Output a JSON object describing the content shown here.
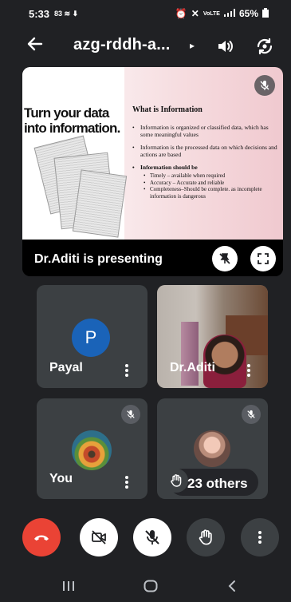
{
  "status_bar": {
    "time": "5:33",
    "left_extras": "83 ≋ ⬇",
    "signal_text": "VoLTE",
    "battery": "65%"
  },
  "header": {
    "meeting_code": "azg-rddh-a...",
    "caret": "▸"
  },
  "presentation": {
    "slide": {
      "heading": "Turn your data into information.",
      "title": "What is Information",
      "bullets": [
        "Information is organized or classified data, which has some meaningful values",
        "Information is the processed data on which decisions and actions are based",
        "Information should be"
      ],
      "sub_bullets": [
        "Timely – available when required",
        "Accuracy – Accurate and reliable",
        "Completeness–Should be complete. as incomplete information is dangerous"
      ]
    },
    "label": "Dr.Aditi is presenting"
  },
  "participants": {
    "payal": {
      "name": "Payal",
      "initial": "P"
    },
    "aditi": {
      "name": "Dr.Aditi"
    },
    "you": {
      "name": "You"
    },
    "others": {
      "text": "23 others"
    }
  },
  "colors": {
    "background": "#202124",
    "tile": "#3c4043",
    "end_call": "#ea4335",
    "avatar_blue": "#1a63b8"
  },
  "icons": [
    "back-arrow-icon",
    "speaker-icon",
    "switch-camera-icon",
    "mic-off-icon",
    "pin-off-icon",
    "fullscreen-icon",
    "kebab-icon",
    "end-call-icon",
    "camera-off-icon",
    "raise-hand-icon"
  ]
}
